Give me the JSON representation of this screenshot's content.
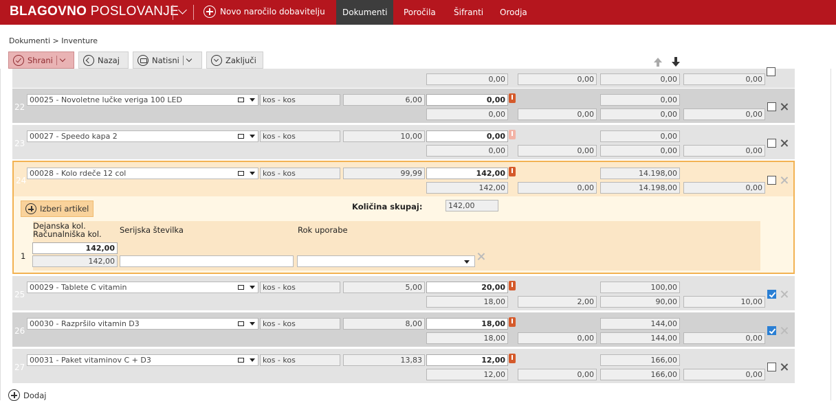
{
  "app": {
    "brand_bold": "BLAGOVNO",
    "brand_light": "POSLOVANJE",
    "new_order_label": "Novo naročilo dobavitelju",
    "nav": [
      "Dokumenti",
      "Poročila",
      "Šifranti",
      "Orodja"
    ],
    "active_nav": "Dokumenti",
    "accent_color": "#b5161e"
  },
  "breadcrumb": "Dokumenti > Inventure",
  "toolbar": {
    "save": "Shrani",
    "back": "Nazaj",
    "print": "Natisni",
    "close": "Zaključi"
  },
  "top_partial_row": {
    "values": [
      "0,00",
      "0,00",
      "0,00",
      "0,00"
    ]
  },
  "rows": [
    {
      "num": "22",
      "article": "00025 - Novoletne lučke veriga 100 LED",
      "unit": "kos - kos",
      "price": "6,00",
      "actual": "0,00",
      "computed": "0,00",
      "diff": "0,00",
      "value_actual": "0,00",
      "value_computed": "0,00",
      "value_diff": "0,00",
      "checked": false,
      "warning_icon": "warning-dark"
    },
    {
      "num": "23",
      "article": "00027 - Speedo kapa 2",
      "unit": "kos - kos",
      "price": "10,00",
      "actual": "0,00",
      "computed": "0,00",
      "diff": "0,00",
      "value_actual": "0,00",
      "value_computed": "0,00",
      "value_diff": "0,00",
      "checked": false,
      "warning_icon": "warning-light"
    },
    {
      "num": "24",
      "article": "00028 - Kolo rdeče 12 col",
      "unit": "kos - kos",
      "price": "99,99",
      "actual": "142,00",
      "computed": "142,00",
      "diff": "0,00",
      "value_actual": "14.198,00",
      "value_computed": "14.198,00",
      "value_diff": "0,00",
      "checked": false,
      "warning_icon": "warning-dark"
    },
    {
      "num": "25",
      "article": "00029 - Tablete C vitamin",
      "unit": "kos - kos",
      "price": "5,00",
      "actual": "20,00",
      "computed": "18,00",
      "diff": "2,00",
      "value_actual": "100,00",
      "value_computed": "90,00",
      "value_diff": "10,00",
      "checked": true,
      "warning_icon": "warning-dark"
    },
    {
      "num": "26",
      "article": "00030 - Razpršilo vitamin D3",
      "unit": "kos - kos",
      "price": "8,00",
      "actual": "18,00",
      "computed": "18,00",
      "diff": "0,00",
      "value_actual": "144,00",
      "value_computed": "144,00",
      "value_diff": "0,00",
      "checked": true,
      "warning_icon": "warning-dark"
    },
    {
      "num": "27",
      "article": "00031 - Paket vitaminov C + D3",
      "unit": "kos - kos",
      "price": "13,83",
      "actual": "12,00",
      "computed": "12,00",
      "diff": "0,00",
      "value_actual": "166,00",
      "value_computed": "166,00",
      "value_diff": "0,00",
      "checked": false,
      "warning_icon": "warning-dark"
    }
  ],
  "detail": {
    "select_article": "Izberi artikel",
    "total_qty_label": "Količina skupaj:",
    "total_qty_value": "142,00",
    "col_actual": "Dejanska kol.",
    "col_computed": "Računalniška kol.",
    "col_serial": "Serijska številka",
    "col_expiry": "Rok uporabe",
    "line_num": "1",
    "line_actual": "142,00",
    "line_computed": "142,00",
    "line_serial": "",
    "line_expiry": ""
  },
  "add_label": "Dodaj"
}
